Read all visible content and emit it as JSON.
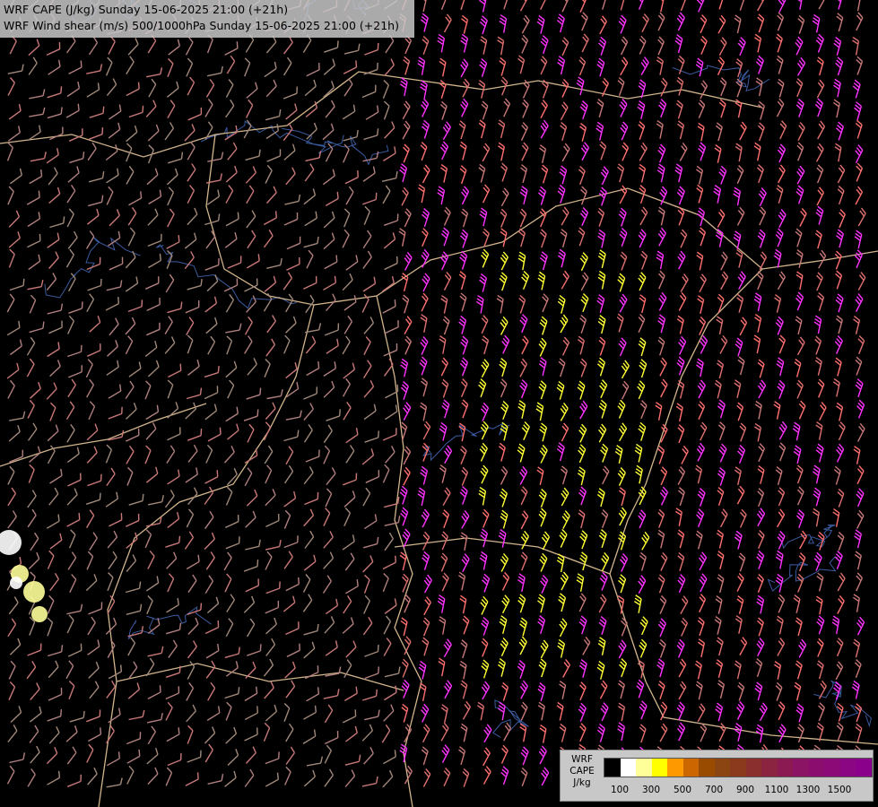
{
  "title": {
    "line1": "WRF CAPE (J/kg) Sunday 15-06-2025 21:00 (+21h)",
    "line2": "WRF Wind shear (m/s) 500/1000hPa Sunday 15-06-2025 21:00 (+21h)"
  },
  "legend": {
    "model": "WRF",
    "field": "CAPE",
    "unit": "J/kg",
    "colors": [
      "#000000",
      "#ffffff",
      "#ffff99",
      "#ffff00",
      "#ff9900",
      "#cc6600",
      "#994c00",
      "#8b4513",
      "#8b3a1e",
      "#8b2e2e",
      "#8b2440",
      "#8b1a52",
      "#8b1464",
      "#8b0e6e",
      "#8b0a78",
      "#8b0682",
      "#8b008b"
    ],
    "ticks": [
      "100",
      "300",
      "500",
      "700",
      "900",
      "1100",
      "1300",
      "1500"
    ]
  },
  "map": {
    "wind_colors": [
      "#a0887a",
      "#b07f7f",
      "#c87878",
      "#e07070",
      "#ff7070",
      "#ff33ff",
      "#ffff33"
    ],
    "border_color": "#d2b48c",
    "river_color": "#3b5ba0"
  }
}
